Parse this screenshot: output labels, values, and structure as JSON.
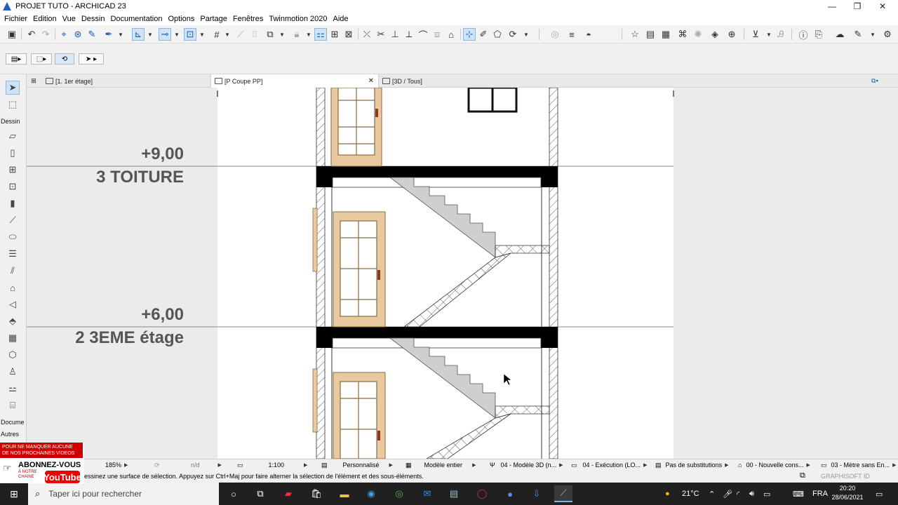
{
  "window": {
    "title": "PROJET TUTO - ARCHICAD 23",
    "controls": {
      "minimize": "—",
      "restore": "❐",
      "close": "✕"
    }
  },
  "menu": {
    "items": [
      "Fichier",
      "Edition",
      "Vue",
      "Dessin",
      "Documentation",
      "Options",
      "Partage",
      "Fenêtres",
      "Twinmotion 2020",
      "Aide"
    ]
  },
  "tabs": [
    {
      "label": "[1. 1er étage]",
      "icon": "floorplan-icon"
    },
    {
      "label": "[P Coupe PP]",
      "icon": "section-icon",
      "close": "✕"
    },
    {
      "label": "[3D / Tous]",
      "icon": "3d-icon"
    }
  ],
  "toolbox": {
    "sections": [
      "Dessin",
      "Docume",
      "Autres"
    ]
  },
  "drawing": {
    "levels": [
      {
        "value": "+9,00",
        "name": "3 TOITURE"
      },
      {
        "value": "+6,00",
        "name": "2 3EME étage"
      }
    ]
  },
  "status": {
    "zoom": "185%",
    "angle": "n/d",
    "scale": "1:100",
    "pen_set": "Personnalisé",
    "model_view": "Modèle entier",
    "view_map": "04 - Modèle 3D (n...",
    "layer_combo": "04 - Exécution (LO...",
    "overrides": "Pas de substitutions",
    "renovation": "00 - Nouvelle cons...",
    "dimension": "03 - Mètre sans En..."
  },
  "hint": {
    "text": "essinez une surface de sélection. Appuyez sur Ctrl+Maj pour faire alterner la sélection de l'élément et des sous-éléments.",
    "brand": "GRAPHISOFT ID"
  },
  "youtube": {
    "line1": "POUR NE MANQUER AUCUNE",
    "line1b": "DE NOS PROCHAINES VIDEOS",
    "subscribe": "ABONNEZ-VOUS",
    "chain": "À NOTRE CHAINE",
    "logo": "YouTube"
  },
  "taskbar": {
    "search_placeholder": "Taper ici pour rechercher",
    "weather": "21°C",
    "lang": "FRA",
    "time": "20:20",
    "date": "28/06/2021"
  }
}
